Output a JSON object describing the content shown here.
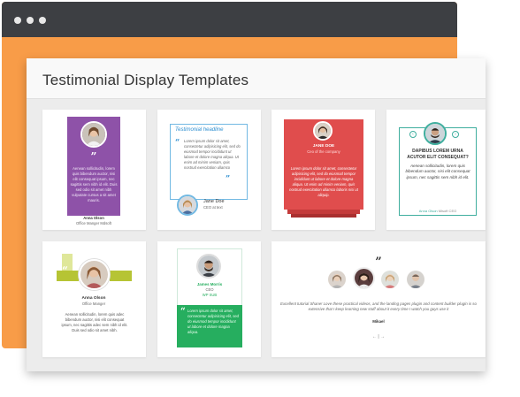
{
  "panel": {
    "title": "Testimonial Display Templates"
  },
  "colors": {
    "window_bar": "#3d3f43",
    "window_orange": "#f89c48",
    "purple": "#8e52a8",
    "blue": "#2e8fd0",
    "red": "#e04d4d",
    "teal": "#3fae9e",
    "lime": "#b6c434",
    "green": "#26ae5f"
  },
  "cards": {
    "c1": {
      "quote": "”",
      "text": "Aenean sollicitudin, lorem quis bibendum auctor, nisi elit consequat ipsum, nec sagittis sem nibh id elit. Duis sed odio sit amet nibh vulputate cursus a sit amet mauris.",
      "name": "Anna Olson",
      "role": "Office Manger Mdsoft"
    },
    "c2": {
      "headline": "Testimonial headline",
      "quote_open": "“",
      "quote_close": "”",
      "text": "Lorem ipsum dolor sit amet, consectetur adipisicing elit, sed do eiusmod tempor incididunt ut labore et dolore magna aliqua. Ut enim ad minim veniam, quis nostrud exercitation ullamco",
      "name": "Jane Doe",
      "role": "CEO at text"
    },
    "c3": {
      "name": "JANE DOE",
      "role": "Ceo of the company",
      "text": "Lorem ipsum dolor sit amet, consectetur adipisicing elit, sed do eiusmod tempor incididunt ut labore et dolore magna aliqua. Ut enim ad minim veniam, quis nostrud exercitation ullamco laboris nisi ut aliquip."
    },
    "c4": {
      "prev": "‹",
      "next": "›",
      "title": "DAPIBUS LOREM URNA ACUTOR ELIT CONSEQUAT?",
      "text": "Aenean sollicitudin, lorem quis bibendum auctor, nisi elit consequat ipsum, nec sagittis sem nibh id elit.",
      "name": "Anna Olson",
      "role": "Misoft CEO"
    },
    "c5": {
      "name": "Anna Olson",
      "role": "Office Manger",
      "text": "Aenean sollicitudin, lorem quis adec bibendum auctor, nisi elit consequat ipsum, nec sagittis adec sem nibh id elit. Duis sed odio sit amet nibh."
    },
    "c6": {
      "name": "James Morris",
      "role": "CEO",
      "company": "WP SUB",
      "quote": "“",
      "text": "Lorem ipsum dolor sit amet, consectetur adipisicing elit, sed do eiusmod tempor incididunt ut labore et dolore magna aliqua."
    },
    "c7": {
      "quote": "”",
      "text": "Excellent tutorial Shane! Love these practical videos, and the landing pages plugin and content builder plugin is so extensive that I keep learning new stuff about it every time I watch you guys use it",
      "name": "Mikael",
      "nav": "← | →"
    }
  }
}
